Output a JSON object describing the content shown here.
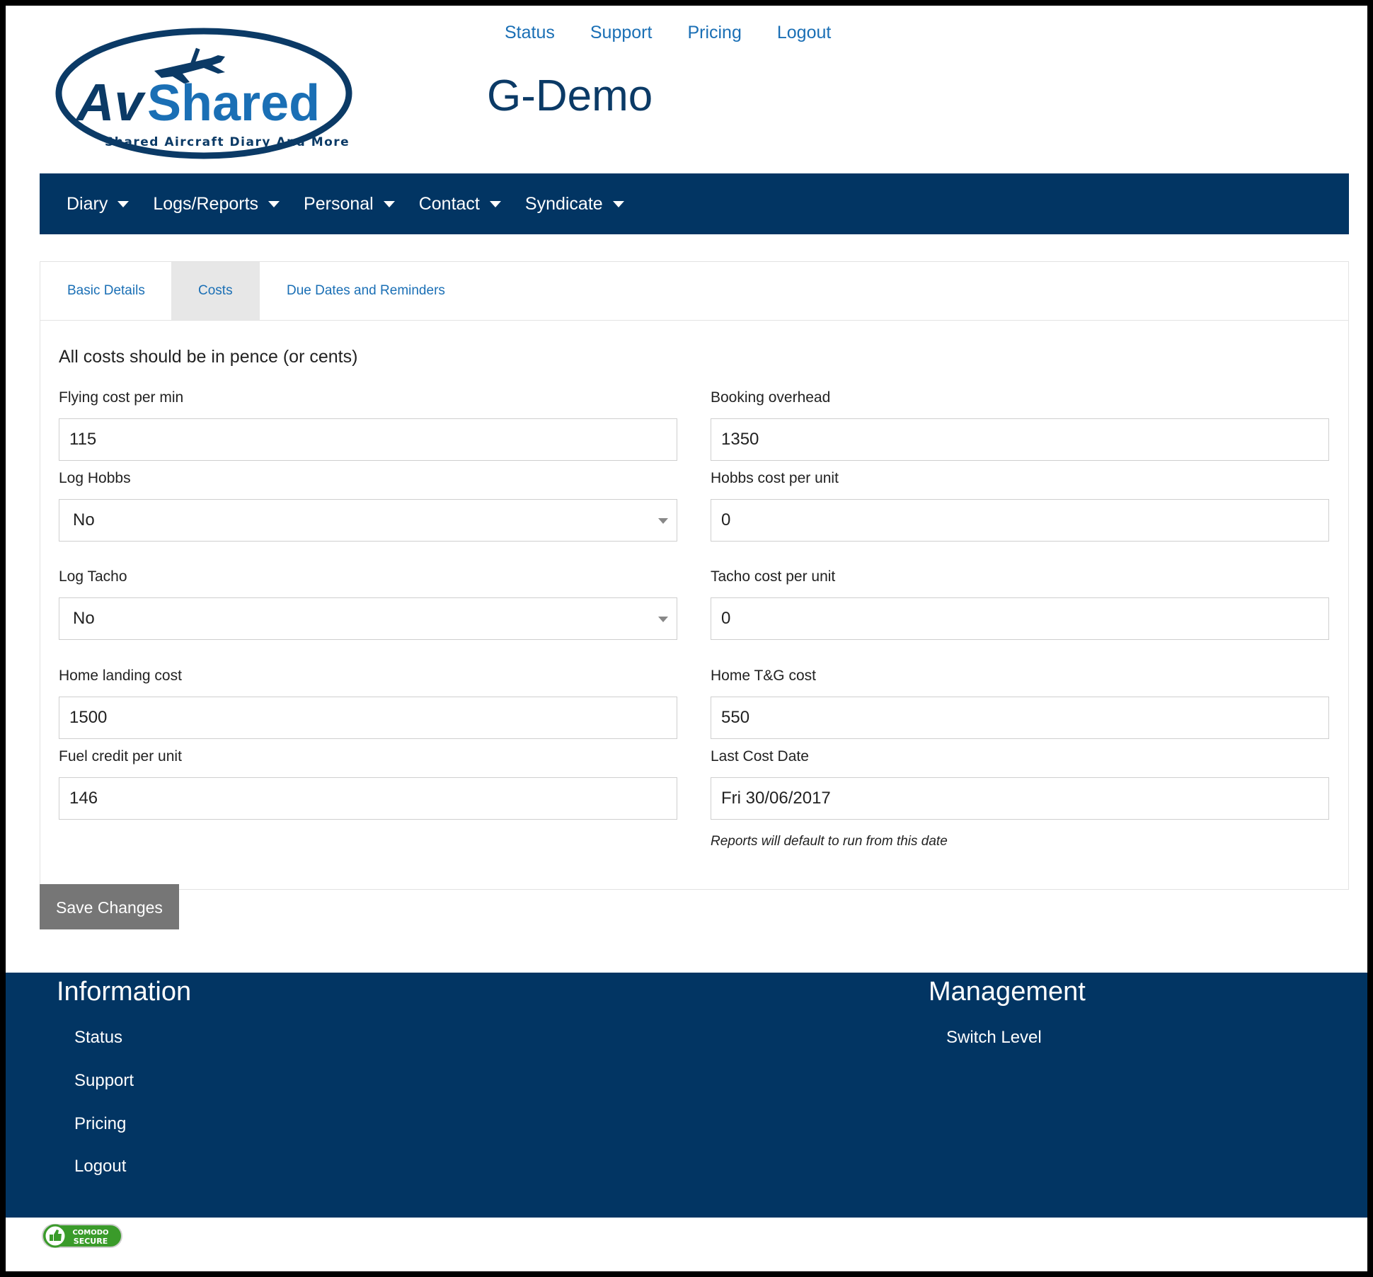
{
  "brand": {
    "logo_name": "AvShared",
    "logo_tagline": "Shared Aircraft Diary And More"
  },
  "top_links": [
    "Status",
    "Support",
    "Pricing",
    "Logout"
  ],
  "aircraft_title": "G-Demo",
  "nav": [
    "Diary",
    "Logs/Reports",
    "Personal",
    "Contact",
    "Syndicate"
  ],
  "tabs": [
    "Basic Details",
    "Costs",
    "Due Dates and Reminders"
  ],
  "active_tab": "Costs",
  "intro": "All costs should be in pence (or cents)",
  "fields": {
    "flying_cost": {
      "label": "Flying cost per min",
      "value": "115"
    },
    "booking_overhead": {
      "label": "Booking overhead",
      "value": "1350"
    },
    "log_hobbs": {
      "label": "Log Hobbs",
      "value": "No"
    },
    "hobbs_cost": {
      "label": "Hobbs cost per unit",
      "value": "0"
    },
    "log_tacho": {
      "label": "Log Tacho",
      "value": "No"
    },
    "tacho_cost": {
      "label": "Tacho cost per unit",
      "value": "0"
    },
    "home_landing": {
      "label": "Home landing cost",
      "value": "1500"
    },
    "home_tg": {
      "label": "Home T&G cost",
      "value": "550"
    },
    "fuel_credit": {
      "label": "Fuel credit per unit",
      "value": "146"
    },
    "last_cost_date": {
      "label": "Last Cost Date",
      "value": "Fri 30/06/2017"
    }
  },
  "last_cost_help": "Reports will default to run from this date",
  "save_label": "Save Changes",
  "footer": {
    "info_heading": "Information",
    "info_links": [
      "Status",
      "Support",
      "Pricing",
      "Logout"
    ],
    "mgmt_heading": "Management",
    "mgmt_links": [
      "Switch Level"
    ]
  },
  "badge": {
    "line1": "COMODO",
    "line2": "SECURE"
  },
  "colors": {
    "navy": "#023563",
    "link": "#1a6fb5",
    "title": "#0b3a66",
    "button": "#767676"
  }
}
